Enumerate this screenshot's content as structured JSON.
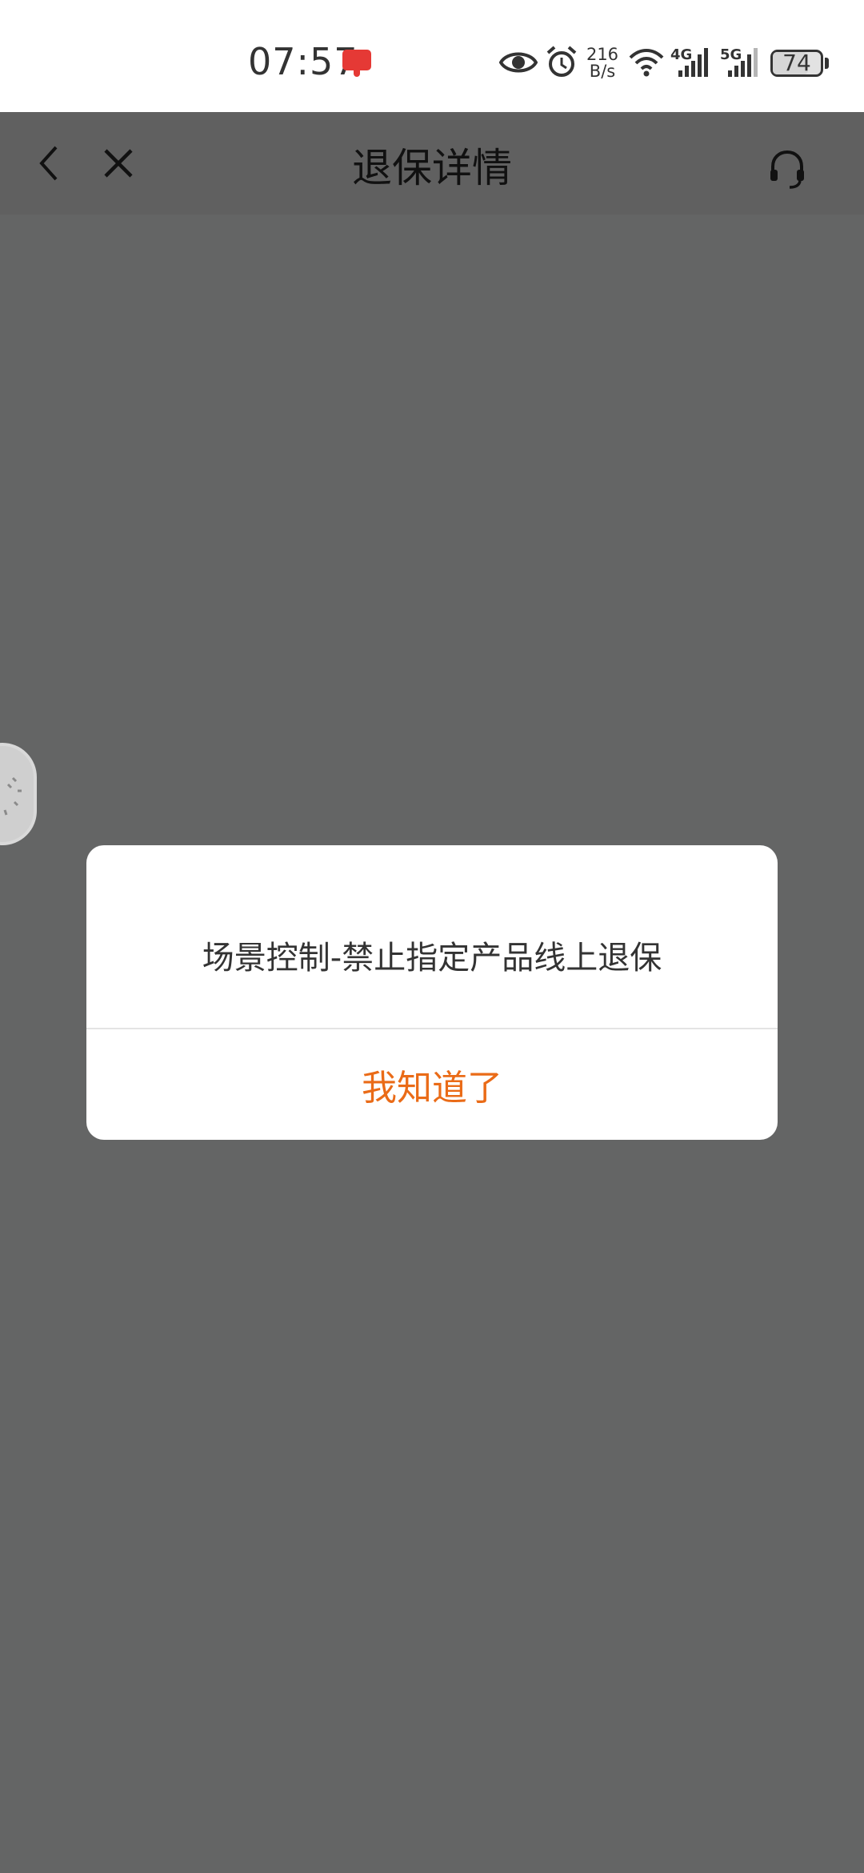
{
  "status_bar": {
    "time": "07:57",
    "net_speed_value": "216",
    "net_speed_unit": "B/s",
    "net1": "4G",
    "net2": "5G",
    "battery": "74",
    "battery_level": 0.74
  },
  "header": {
    "title": "退保详情",
    "back_icon": "chevron-left-icon",
    "close_icon": "close-icon",
    "service_icon": "headset-icon"
  },
  "dialog": {
    "message": "场景控制-禁止指定产品线上退保",
    "button_label": "我知道了",
    "button_color": "#ea6b17"
  },
  "colors": {
    "overlay": "#646565",
    "accent": "#ea6b17"
  }
}
